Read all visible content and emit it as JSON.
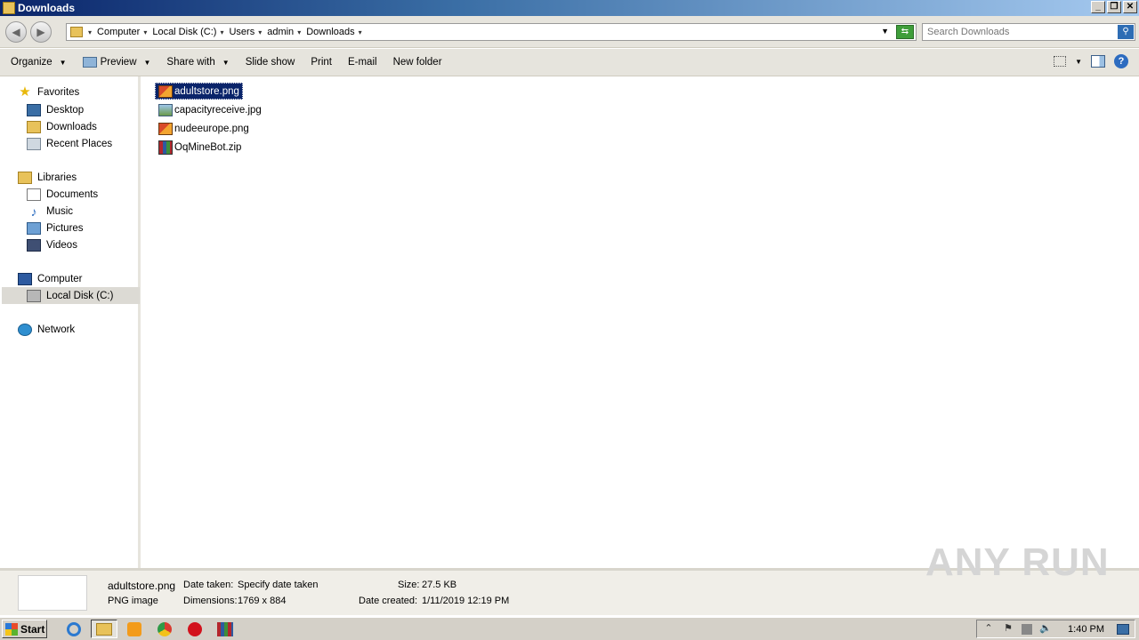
{
  "window": {
    "title": "Downloads"
  },
  "window_buttons": {
    "minimize": "_",
    "restore": "❐",
    "close": "✕"
  },
  "nav_buttons": {
    "back": "◀",
    "forward": "▶"
  },
  "address": {
    "crumbs": [
      "Computer",
      "Local Disk (C:)",
      "Users",
      "admin",
      "Downloads"
    ]
  },
  "search": {
    "placeholder": "Search Downloads"
  },
  "toolbar": {
    "organize": "Organize",
    "preview": "Preview",
    "share_with": "Share with",
    "slide_show": "Slide show",
    "print": "Print",
    "email": "E-mail",
    "new_folder": "New folder",
    "help": "?"
  },
  "nav": {
    "favorites": "Favorites",
    "desktop": "Desktop",
    "downloads": "Downloads",
    "recent_places": "Recent Places",
    "libraries": "Libraries",
    "documents": "Documents",
    "music": "Music",
    "pictures": "Pictures",
    "videos": "Videos",
    "computer": "Computer",
    "local_disk": "Local Disk (C:)",
    "network": "Network"
  },
  "files": [
    {
      "name": "adultstore.png",
      "icon": "png-icon",
      "selected": true
    },
    {
      "name": "capacityreceive.jpg",
      "icon": "jpg-icon",
      "selected": false
    },
    {
      "name": "nudeeurope.png",
      "icon": "png-icon",
      "selected": false
    },
    {
      "name": "OqMineBot.zip",
      "icon": "zip-icon",
      "selected": false
    }
  ],
  "details": {
    "filename": "adultstore.png",
    "filetype": "PNG image",
    "date_taken_label": "Date taken:",
    "date_taken_value": "Specify date taken",
    "dimensions_label": "Dimensions:",
    "dimensions_value": "1769 x 884",
    "size_label": "Size:",
    "size_value": "27.5 KB",
    "date_created_label": "Date created:",
    "date_created_value": "1/11/2019 12:19 PM"
  },
  "watermark": "ANY RUN",
  "taskbar": {
    "start": "Start",
    "clock": "1:40 PM",
    "tray_up": "⌃",
    "flag": "⚑",
    "speaker": "🔈"
  },
  "colors": {
    "selection": "#0a246a",
    "titlebar": "#0a246a"
  }
}
